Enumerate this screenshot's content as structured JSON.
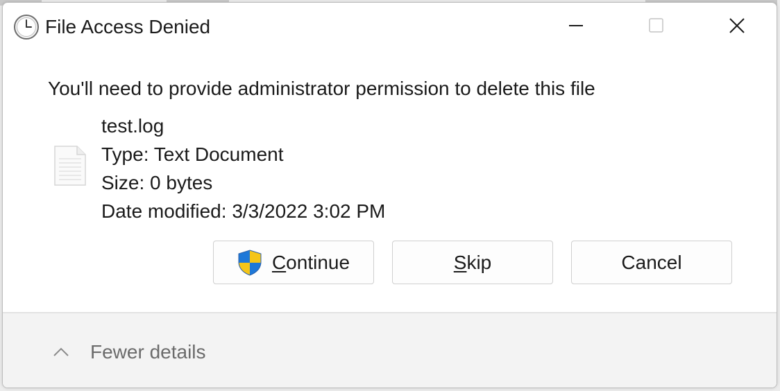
{
  "window": {
    "title": "File Access Denied",
    "icon": "clock-icon",
    "controls": {
      "minimize_icon": "minimize-icon",
      "maximize_icon": "maximize-icon",
      "close_icon": "close-icon"
    }
  },
  "message": {
    "headline": "You'll need to provide administrator permission to delete this file"
  },
  "file": {
    "icon": "text-document-icon",
    "name": "test.log",
    "type": "Type: Text Document",
    "size": "Size: 0 bytes",
    "modified": "Date modified: 3/3/2022 3:02 PM"
  },
  "buttons": {
    "continue": {
      "mnemonic": "C",
      "rest": "ontinue",
      "icon": "uac-shield-icon"
    },
    "skip": {
      "mnemonic": "S",
      "rest": "kip"
    },
    "cancel": {
      "label": "Cancel"
    }
  },
  "footer": {
    "toggle_label": "Fewer details",
    "toggle_icon": "chevron-up-icon"
  },
  "colors": {
    "shield_blue": "#1e78d8",
    "shield_yellow": "#f5c518",
    "footer_bg": "#f3f3f3"
  }
}
